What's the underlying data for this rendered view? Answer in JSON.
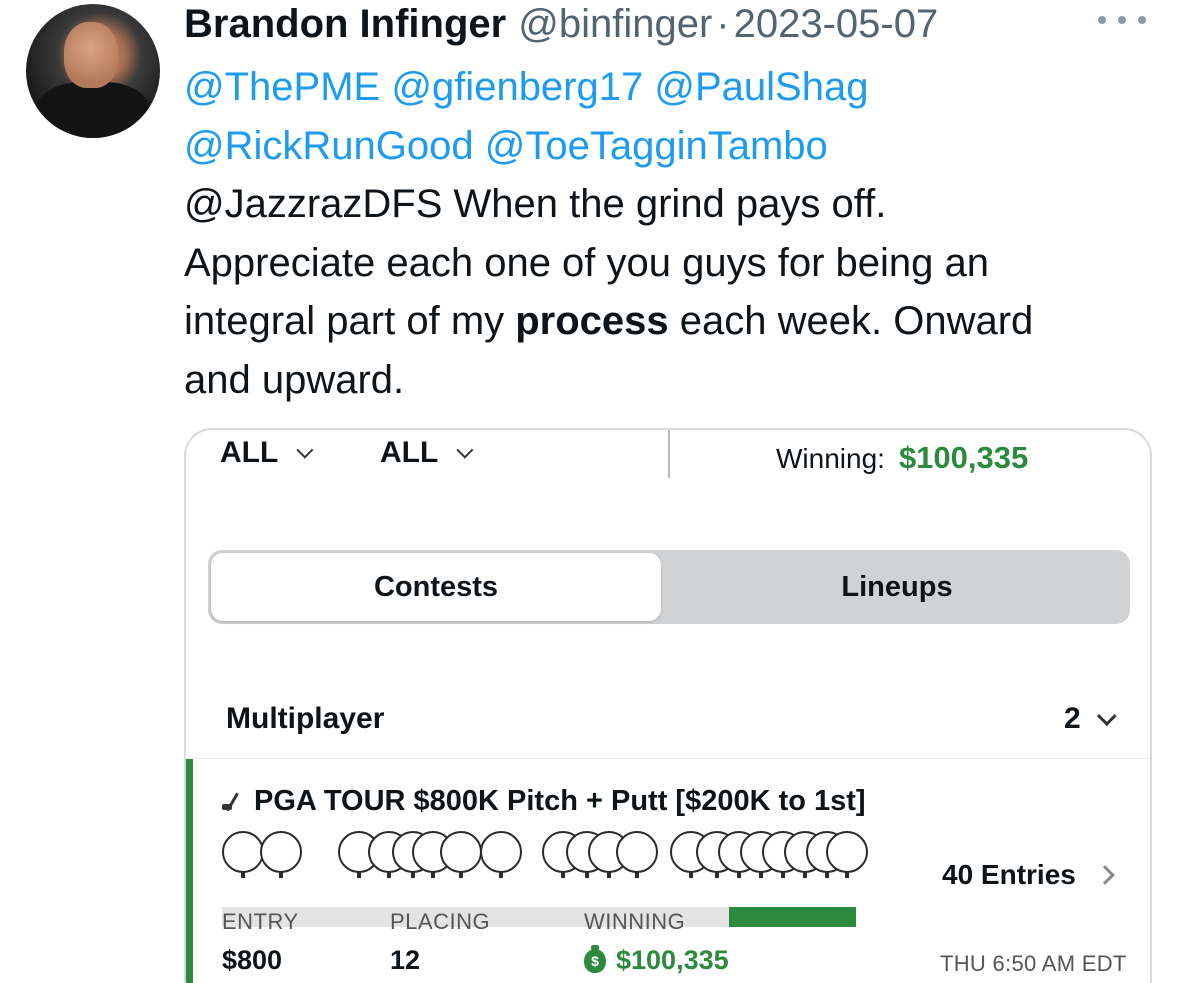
{
  "author": {
    "name": "Brandon Infinger",
    "handle": "@binfinger",
    "separator": "·",
    "date": "2023-05-07"
  },
  "tweet": {
    "mentions_line1": [
      "@ThePME",
      "@gfienberg17",
      "@PaulShag"
    ],
    "mentions_line2": [
      "@RickRunGood",
      "@ToeTagginTambo"
    ],
    "line3_mention": "@JazzrazDFS",
    "line3_text": " When the grind pays off.",
    "line4": "Appreciate each one of you guys for being an",
    "line5_pre": "integral part of my ",
    "line5_bold": "process",
    "line5_post": " each week. Onward",
    "line6": "and upward."
  },
  "app": {
    "filters": [
      "ALL",
      "ALL"
    ],
    "winning_label": "Winning:",
    "winning_amount": "$100,335",
    "tabs": {
      "active": "Contests",
      "inactive": "Lineups"
    },
    "section_title": "Multiplayer",
    "section_count": "2",
    "contest": {
      "title": "PGA TOUR $800K Pitch + Putt [$200K to 1st]",
      "entries": "40 Entries",
      "entry_label": "ENTRY",
      "entry_value": "$800",
      "placing_label": "PLACING",
      "placing_value": "12",
      "winning_label": "WINNING",
      "winning_value": "$100,335",
      "time": "THU 6:50 AM EDT",
      "winning_share": 0.2
    },
    "colors": {
      "accent_green": "#2b8a3e",
      "link_blue": "#1d9bf0"
    }
  },
  "icons": [
    "more-icon",
    "chevron-down-icon",
    "golf-club-icon",
    "money-bag-icon",
    "chevron-right-icon"
  ]
}
